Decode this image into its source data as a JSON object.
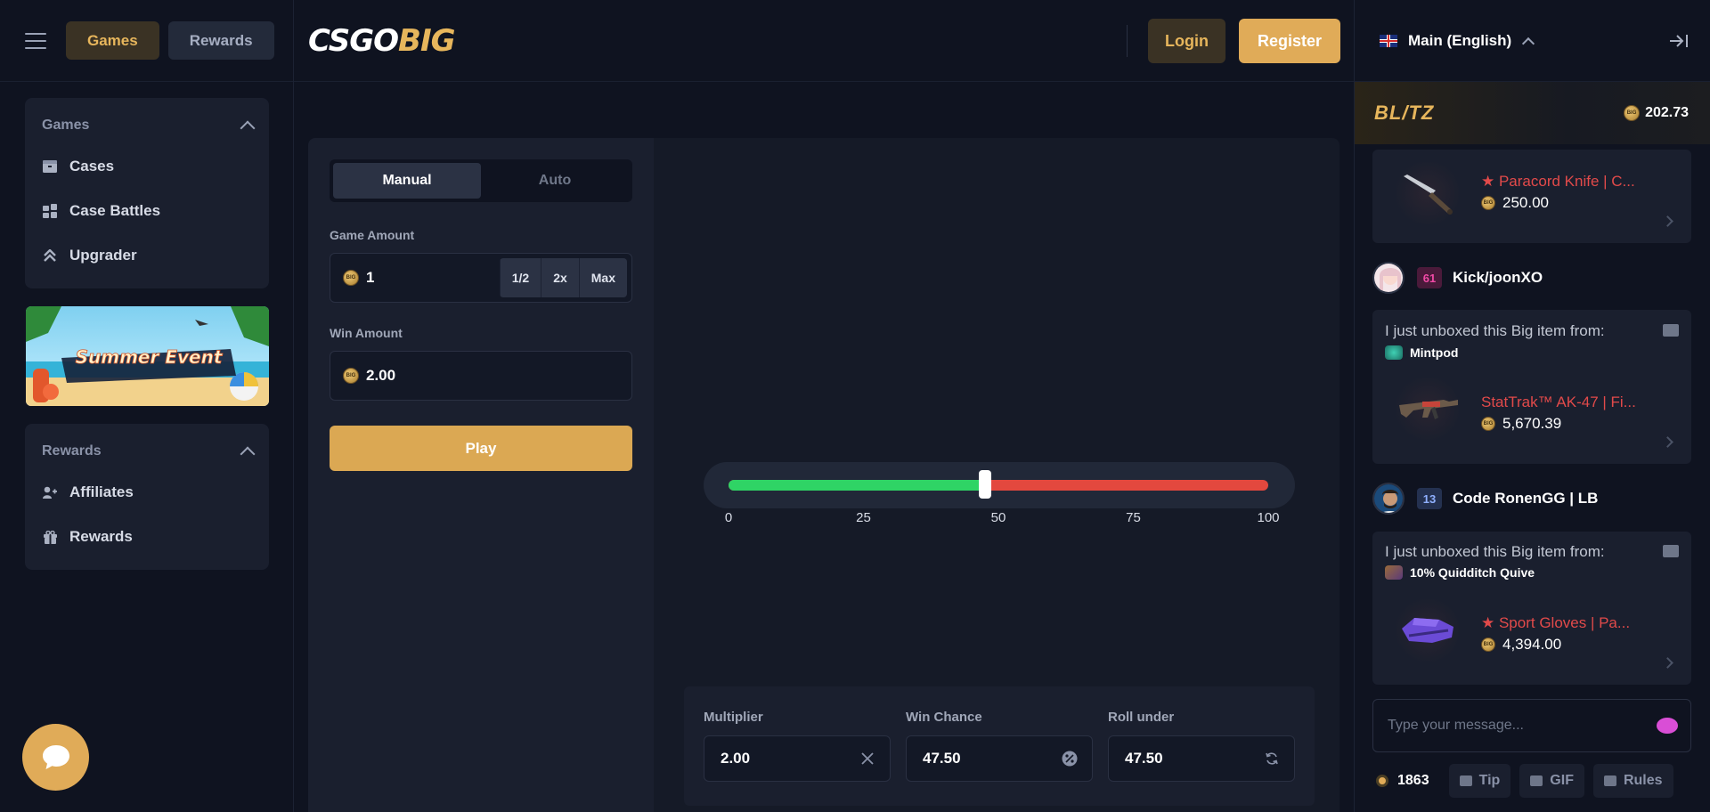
{
  "colors": {
    "accent": "#e0ab58",
    "win": "#2fd465",
    "lose": "#e3483e",
    "bg": "#0f1320",
    "panel": "#1a1f2e"
  },
  "nav": {
    "tabs": [
      {
        "label": "Games",
        "active": true
      },
      {
        "label": "Rewards",
        "active": false
      }
    ]
  },
  "sidebar": {
    "games": {
      "title": "Games",
      "items": [
        {
          "label": "Cases",
          "icon": "box-icon"
        },
        {
          "label": "Case Battles",
          "icon": "battle-icon"
        },
        {
          "label": "Upgrader",
          "icon": "chevrons-up-icon"
        }
      ]
    },
    "banner": {
      "text": "Summer Event"
    },
    "rewards": {
      "title": "Rewards",
      "items": [
        {
          "label": "Affiliates",
          "icon": "user-plus-icon"
        },
        {
          "label": "Rewards",
          "icon": "gift-icon"
        }
      ]
    }
  },
  "header": {
    "logo_white": "CSGO",
    "logo_gold": "BIG",
    "login": "Login",
    "register": "Register"
  },
  "game": {
    "mode": {
      "manual": "Manual",
      "auto": "Auto",
      "selected": "Manual"
    },
    "game_amount": {
      "label": "Game Amount",
      "value": "1",
      "half": "1/2",
      "double": "2x",
      "max": "Max"
    },
    "win_amount": {
      "label": "Win Amount",
      "value": "2.00"
    },
    "play": "Play",
    "slider": {
      "value": 47.5,
      "ticks": [
        "0",
        "25",
        "50",
        "75",
        "100"
      ]
    },
    "stats": {
      "multiplier": {
        "label": "Multiplier",
        "value": "2.00"
      },
      "win_chance": {
        "label": "Win Chance",
        "value": "47.50"
      },
      "roll_under": {
        "label": "Roll under",
        "value": "47.50"
      }
    }
  },
  "chat": {
    "language": "Main (English)",
    "blitz": {
      "label": "BL/TZ",
      "value": "202.73"
    },
    "feed": [
      {
        "item_name": "★ Paracord Knife | C...",
        "price": "250.00"
      },
      {
        "user": "Kick/joonXO",
        "level": "61",
        "message": "I just unboxed this Big item from:",
        "case": "Mintpod",
        "item_name": "StatTrak™ AK-47 | Fi...",
        "price": "5,670.39"
      },
      {
        "user": "Code RonenGG | LB",
        "level": "13",
        "message": "I just unboxed this Big item from:",
        "case": "10% Quidditch Quive",
        "item_name": "★ Sport Gloves | Pa...",
        "price": "4,394.00"
      }
    ],
    "input_placeholder": "Type your message...",
    "online": "1863",
    "buttons": {
      "tip": "Tip",
      "gif": "GIF",
      "rules": "Rules"
    }
  }
}
